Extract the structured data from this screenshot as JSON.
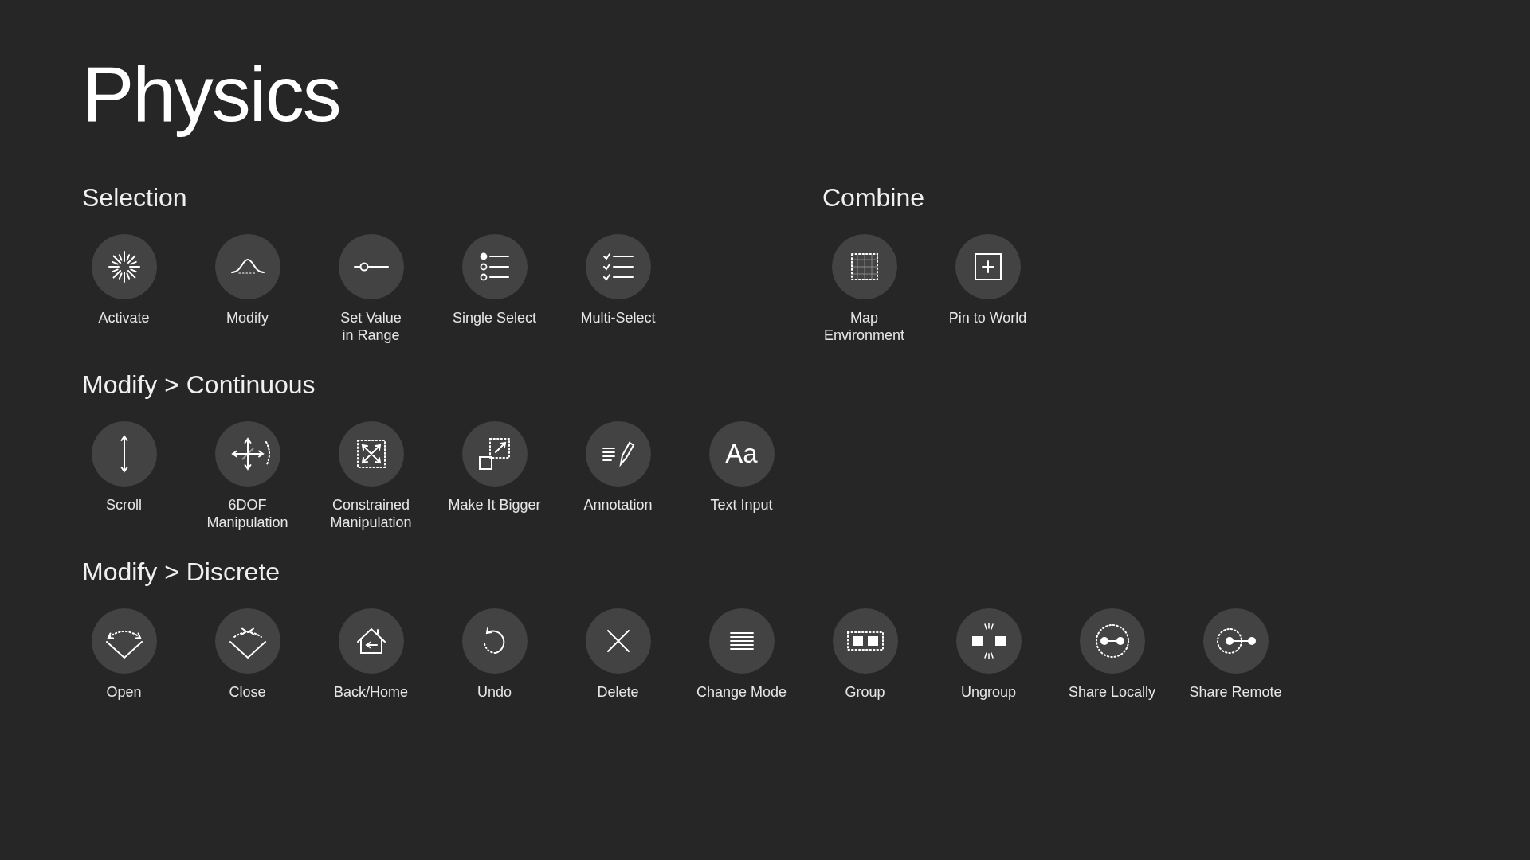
{
  "title": "Physics",
  "sections": [
    {
      "title": "Selection",
      "items": [
        {
          "label": "Activate",
          "kind": "burst"
        },
        {
          "label": "Modify",
          "kind": "curve"
        },
        {
          "label": "Set Value\nin Range",
          "kind": "slider"
        },
        {
          "label": "Single Select",
          "kind": "radio-list"
        },
        {
          "label": "Multi-Select",
          "kind": "check-list"
        }
      ]
    },
    {
      "title": "Combine",
      "items": [
        {
          "label": "Map\nEnvironment",
          "kind": "dotted-grid"
        },
        {
          "label": "Pin to World",
          "kind": "plus-square"
        }
      ]
    },
    {
      "title": "Modify > Continuous",
      "items": [
        {
          "label": "Scroll",
          "kind": "vertical-arrow"
        },
        {
          "label": "6DOF\nManipulation",
          "kind": "move-arrows"
        },
        {
          "label": "Constrained\nManipulation",
          "kind": "expand-square"
        },
        {
          "label": "Make It Bigger",
          "kind": "scale-square"
        },
        {
          "label": "Annotation",
          "kind": "pencil-lines"
        },
        {
          "label": "Text Input",
          "kind": "glyph",
          "glyph": "Aa"
        }
      ]
    },
    {
      "title": "Modify > Discrete",
      "items": [
        {
          "label": "Open",
          "kind": "open-chevron"
        },
        {
          "label": "Close",
          "kind": "close-chevron"
        },
        {
          "label": "Back/Home",
          "kind": "house"
        },
        {
          "label": "Undo",
          "kind": "undo-arrow"
        },
        {
          "label": "Delete",
          "kind": "cross"
        },
        {
          "label": "Change Mode",
          "kind": "lines"
        },
        {
          "label": "Group",
          "kind": "group"
        },
        {
          "label": "Ungroup",
          "kind": "ungroup"
        },
        {
          "label": "Share Locally",
          "kind": "share-local"
        },
        {
          "label": "Share Remote",
          "kind": "share-remote"
        }
      ]
    }
  ]
}
